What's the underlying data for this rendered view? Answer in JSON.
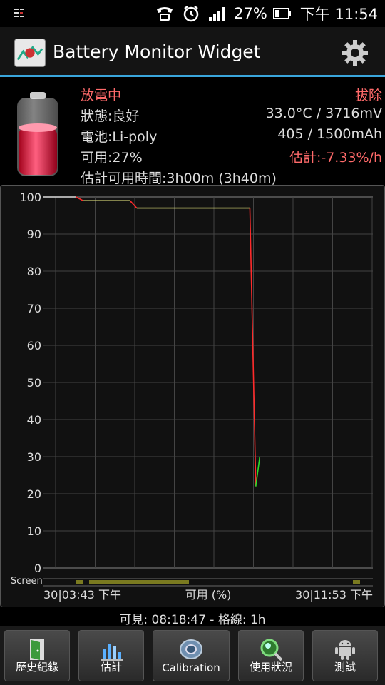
{
  "statusbar": {
    "battery_percent": "27%",
    "time": "下午 11:54"
  },
  "titlebar": {
    "title": "Battery Monitor Widget"
  },
  "info": {
    "status_left": "放電中",
    "status_right": "拔除",
    "health": "狀態:良好",
    "temp_voltage": "33.0°C / 3716mV",
    "battery_type": "電池:Li-poly",
    "capacity": "405 / 1500mAh",
    "available": "可用:27%",
    "estimate_rate": "估計:-7.33%/h",
    "estimate_time": "估計可用時間:3h00m (3h40m)"
  },
  "chart_data": {
    "type": "line",
    "y_ticks": [
      "100",
      "90",
      "80",
      "70",
      "60",
      "50",
      "40",
      "30",
      "20",
      "10",
      "0"
    ],
    "ylim": [
      0,
      100
    ],
    "series": [
      {
        "x": [
          0,
          0.82,
          1.0,
          2.18,
          2.35,
          5.2,
          5.35,
          5.45
        ],
        "values": [
          100,
          100,
          99,
          99,
          97,
          97,
          22,
          30
        ]
      }
    ],
    "screen_label": "Screen",
    "x_start_label": "30|03:43 下午",
    "x_center_label": "可用 (%)",
    "x_end_label": "30|11:53 下午"
  },
  "visible_line": "可見: 08:18:47 - 格線: 1h",
  "buttons": [
    {
      "label": "歷史紀錄",
      "icon": "door-icon"
    },
    {
      "label": "估計",
      "icon": "chart-icon"
    },
    {
      "label": "Calibration",
      "icon": "disc-icon"
    },
    {
      "label": "使用狀況",
      "icon": "magnifier-icon"
    },
    {
      "label": "測試",
      "icon": "android-icon"
    }
  ],
  "colors": {
    "accent": "#3aa6dc",
    "red_text": "#ff6a6a",
    "grid": "#444444"
  }
}
